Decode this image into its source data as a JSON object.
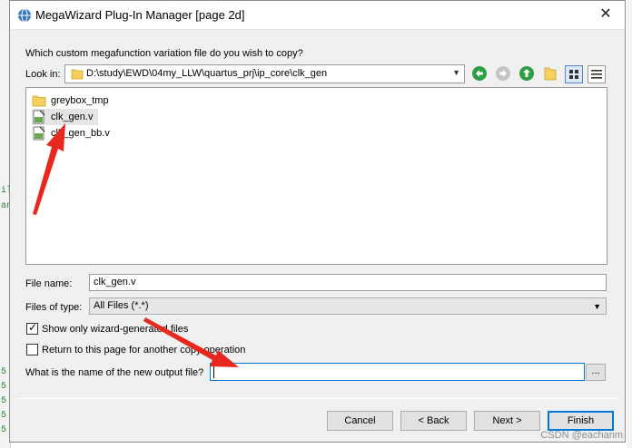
{
  "window": {
    "title": "MegaWizard Plug-In Manager [page 2d]",
    "close_glyph": "✕"
  },
  "prompt": "Which custom megafunction variation file do you wish to copy?",
  "look_in": {
    "label": "Look in:",
    "path": "D:\\study\\EWD\\04my_LLW\\quartus_prj\\ip_core\\clk_gen",
    "dropdown_glyph": "▼"
  },
  "files": [
    {
      "name": "greybox_tmp",
      "type": "folder"
    },
    {
      "name": "clk_gen.v",
      "type": "vfile",
      "selected": true
    },
    {
      "name": "clk_gen_bb.v",
      "type": "vfile"
    }
  ],
  "file_name": {
    "label": "File name:",
    "value": "clk_gen.v"
  },
  "files_of_type": {
    "label": "Files of type:",
    "value": "All Files (*.*)"
  },
  "checkboxes": {
    "show_only": {
      "label": "Show only wizard-generated files",
      "checked": true
    },
    "return_page": {
      "label": "Return to this page for another copy operation",
      "checked": false
    }
  },
  "output_file": {
    "label": "What is the name of the new output file?",
    "value": "",
    "browse_label": "..."
  },
  "buttons": {
    "cancel": "Cancel",
    "back": "< Back",
    "next": "Next >",
    "finish": "Finish"
  },
  "watermark": "CSDN @eachanm",
  "colors": {
    "accent": "#0078d7",
    "annotation_arrow": "#e8281f",
    "nav_green": "#2e9e44",
    "folder": "#f7d05c"
  },
  "background_glyphs": [
    "ile",
    "an",
    "5",
    "5",
    "5",
    "5",
    "5"
  ]
}
